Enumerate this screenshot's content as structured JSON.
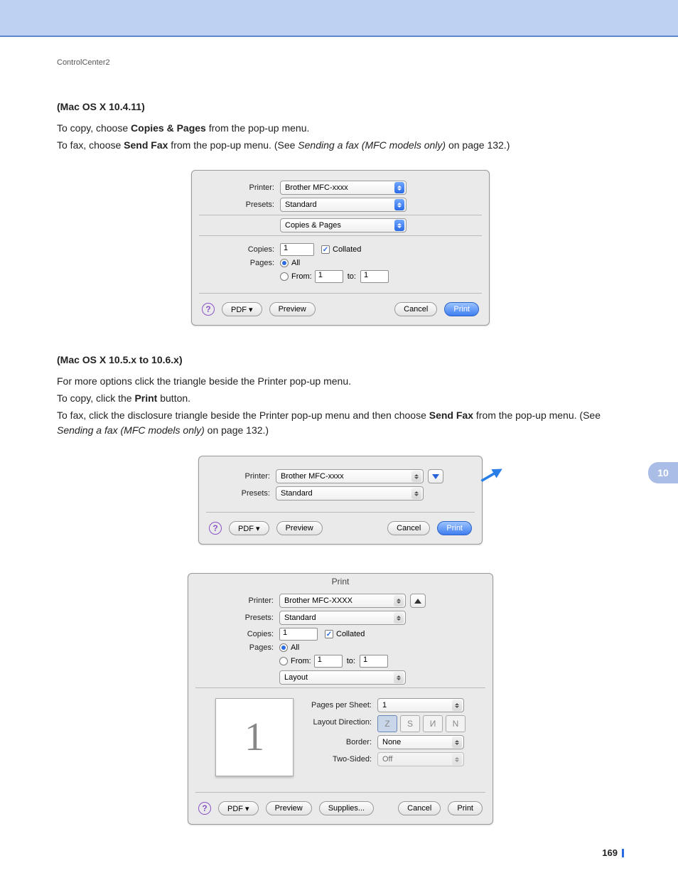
{
  "breadcrumb": "ControlCenter2",
  "page_number": "169",
  "side_tab": "10",
  "section1": {
    "heading": "(Mac OS X 10.4.11)",
    "line1_a": "To copy, choose ",
    "line1_b": "Copies & Pages",
    "line1_c": " from the pop-up menu.",
    "line2_a": "To fax, choose ",
    "line2_b": "Send Fax",
    "line2_c": " from the pop-up menu. (See ",
    "line2_d": "Sending a fax (MFC models only)",
    "line2_e": " on page 132.)"
  },
  "section2": {
    "heading": "(Mac OS X 10.5.x to 10.6.x)",
    "l1": "For more options click the triangle beside the Printer pop-up menu.",
    "l2_a": "To copy, click the ",
    "l2_b": "Print",
    "l2_c": " button.",
    "l3_a": "To fax, click the disclosure triangle beside the Printer pop-up menu and then choose ",
    "l3_b": "Send Fax",
    "l3_c": " from the pop-up menu. (See ",
    "l3_d": "Sending a fax (MFC models only)",
    "l3_e": " on page 132.)"
  },
  "dlg1": {
    "printer_label": "Printer:",
    "printer_value": "Brother MFC-xxxx",
    "presets_label": "Presets:",
    "presets_value": "Standard",
    "section_value": "Copies & Pages",
    "copies_label": "Copies:",
    "copies_value": "1",
    "collated_label": "Collated",
    "pages_label": "Pages:",
    "all_label": "All",
    "from_label": "From:",
    "from_value": "1",
    "to_label": "to:",
    "to_value": "1",
    "pdf": "PDF ▾",
    "preview": "Preview",
    "cancel": "Cancel",
    "print": "Print"
  },
  "dlg2": {
    "printer_label": "Printer:",
    "printer_value": "Brother MFC-xxxx",
    "presets_label": "Presets:",
    "presets_value": "Standard",
    "pdf": "PDF ▾",
    "preview": "Preview",
    "cancel": "Cancel",
    "print": "Print"
  },
  "dlg3": {
    "title": "Print",
    "printer_label": "Printer:",
    "printer_value": "Brother MFC-XXXX",
    "presets_label": "Presets:",
    "presets_value": "Standard",
    "copies_label": "Copies:",
    "copies_value": "1",
    "collated_label": "Collated",
    "pages_label": "Pages:",
    "all_label": "All",
    "from_label": "From:",
    "from_value": "1",
    "to_label": "to:",
    "to_value": "1",
    "section_value": "Layout",
    "pps_label": "Pages per Sheet:",
    "pps_value": "1",
    "ld_label": "Layout Direction:",
    "border_label": "Border:",
    "border_value": "None",
    "ts_label": "Two-Sided:",
    "ts_value": "Off",
    "preview_page": "1",
    "pdf": "PDF ▾",
    "preview": "Preview",
    "supplies": "Supplies...",
    "cancel": "Cancel",
    "print": "Print"
  }
}
